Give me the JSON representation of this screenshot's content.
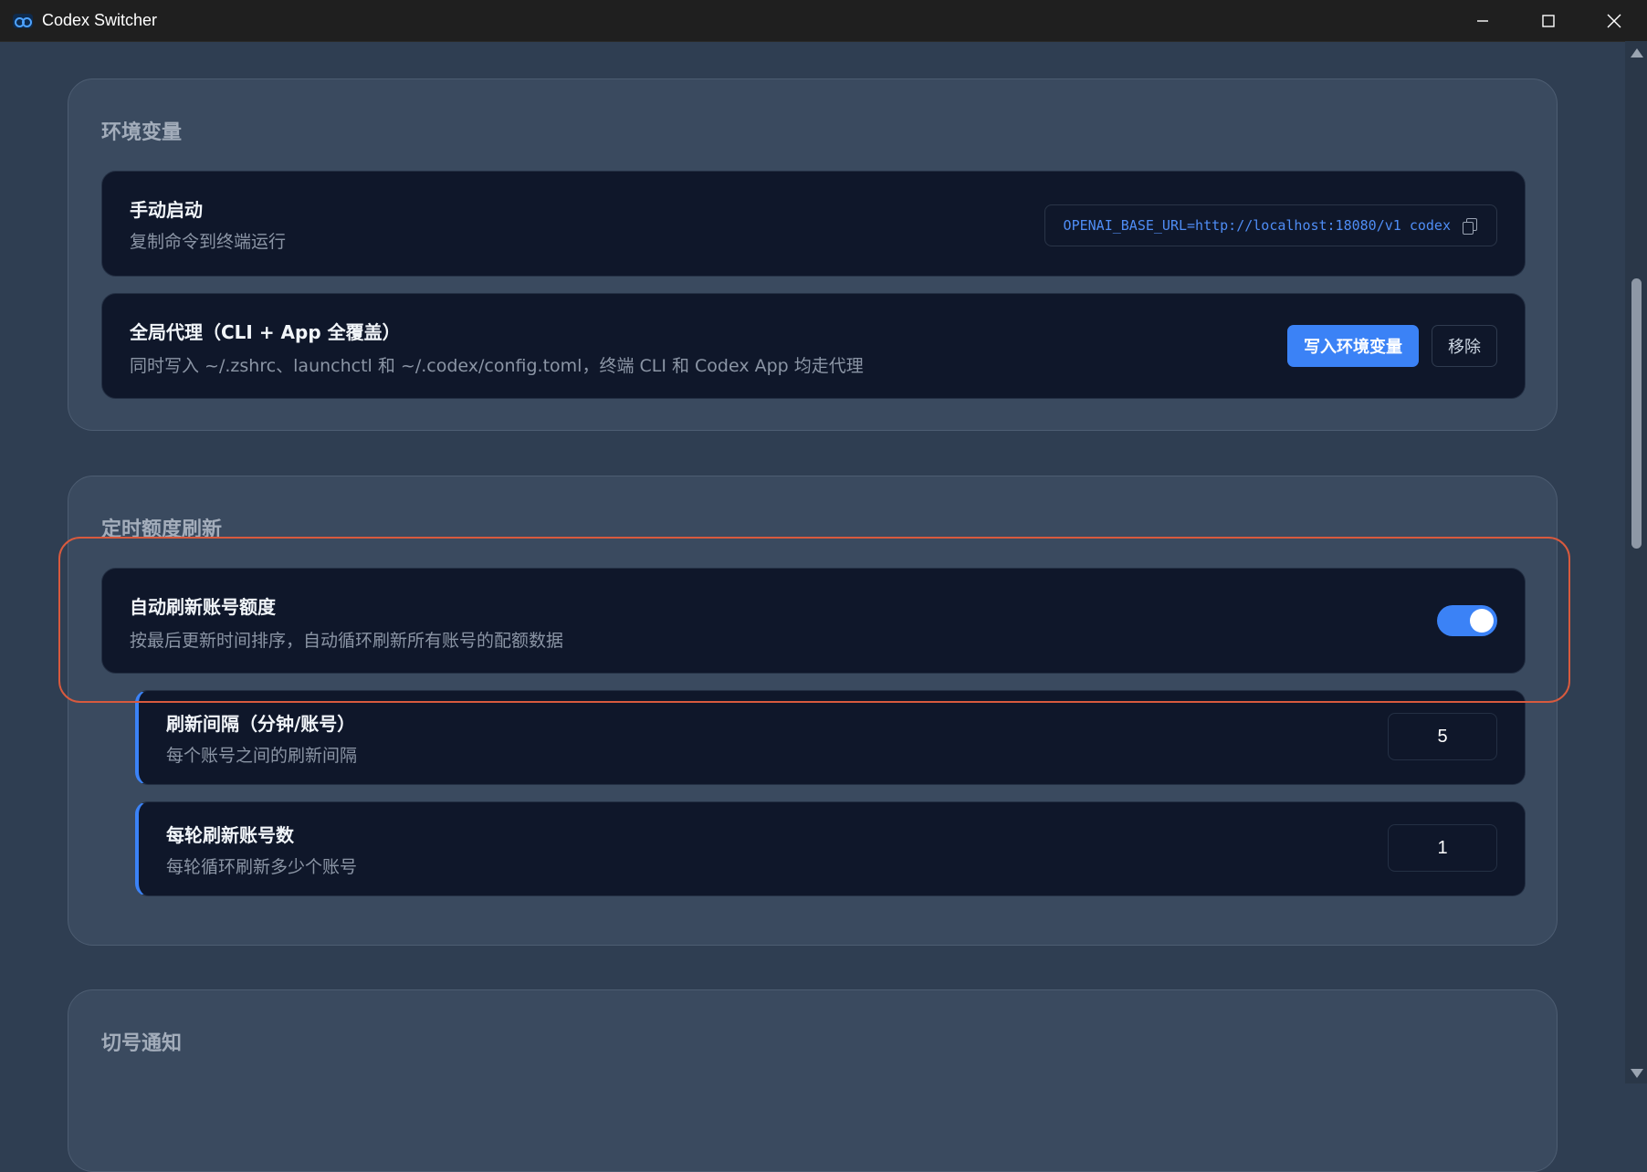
{
  "window": {
    "title": "Codex Switcher"
  },
  "env_section": {
    "title": "环境变量",
    "manual": {
      "title": "手动启动",
      "desc": "复制命令到终端运行",
      "command": "OPENAI_BASE_URL=http://localhost:18080/v1 codex"
    },
    "global_proxy": {
      "title": "全局代理（CLI + App 全覆盖）",
      "desc": "同时写入 ~/.zshrc、launchctl 和 ~/.codex/config.toml，终端 CLI 和 Codex App 均走代理",
      "write_label": "写入环境变量",
      "remove_label": "移除"
    }
  },
  "refresh_section": {
    "title": "定时额度刷新",
    "auto_refresh": {
      "title": "自动刷新账号额度",
      "desc": "按最后更新时间排序，自动循环刷新所有账号的配额数据",
      "enabled": true
    },
    "interval": {
      "title": "刷新间隔（分钟/账号）",
      "desc": "每个账号之间的刷新间隔",
      "value": "5"
    },
    "per_round": {
      "title": "每轮刷新账号数",
      "desc": "每轮循环刷新多少个账号",
      "value": "1"
    }
  },
  "notify_section": {
    "title": "切号通知"
  },
  "colors": {
    "accent": "#3b82f6",
    "highlight": "#d85a3e",
    "card_bg": "#0f172a",
    "section_bg": "#3a4a5f"
  }
}
